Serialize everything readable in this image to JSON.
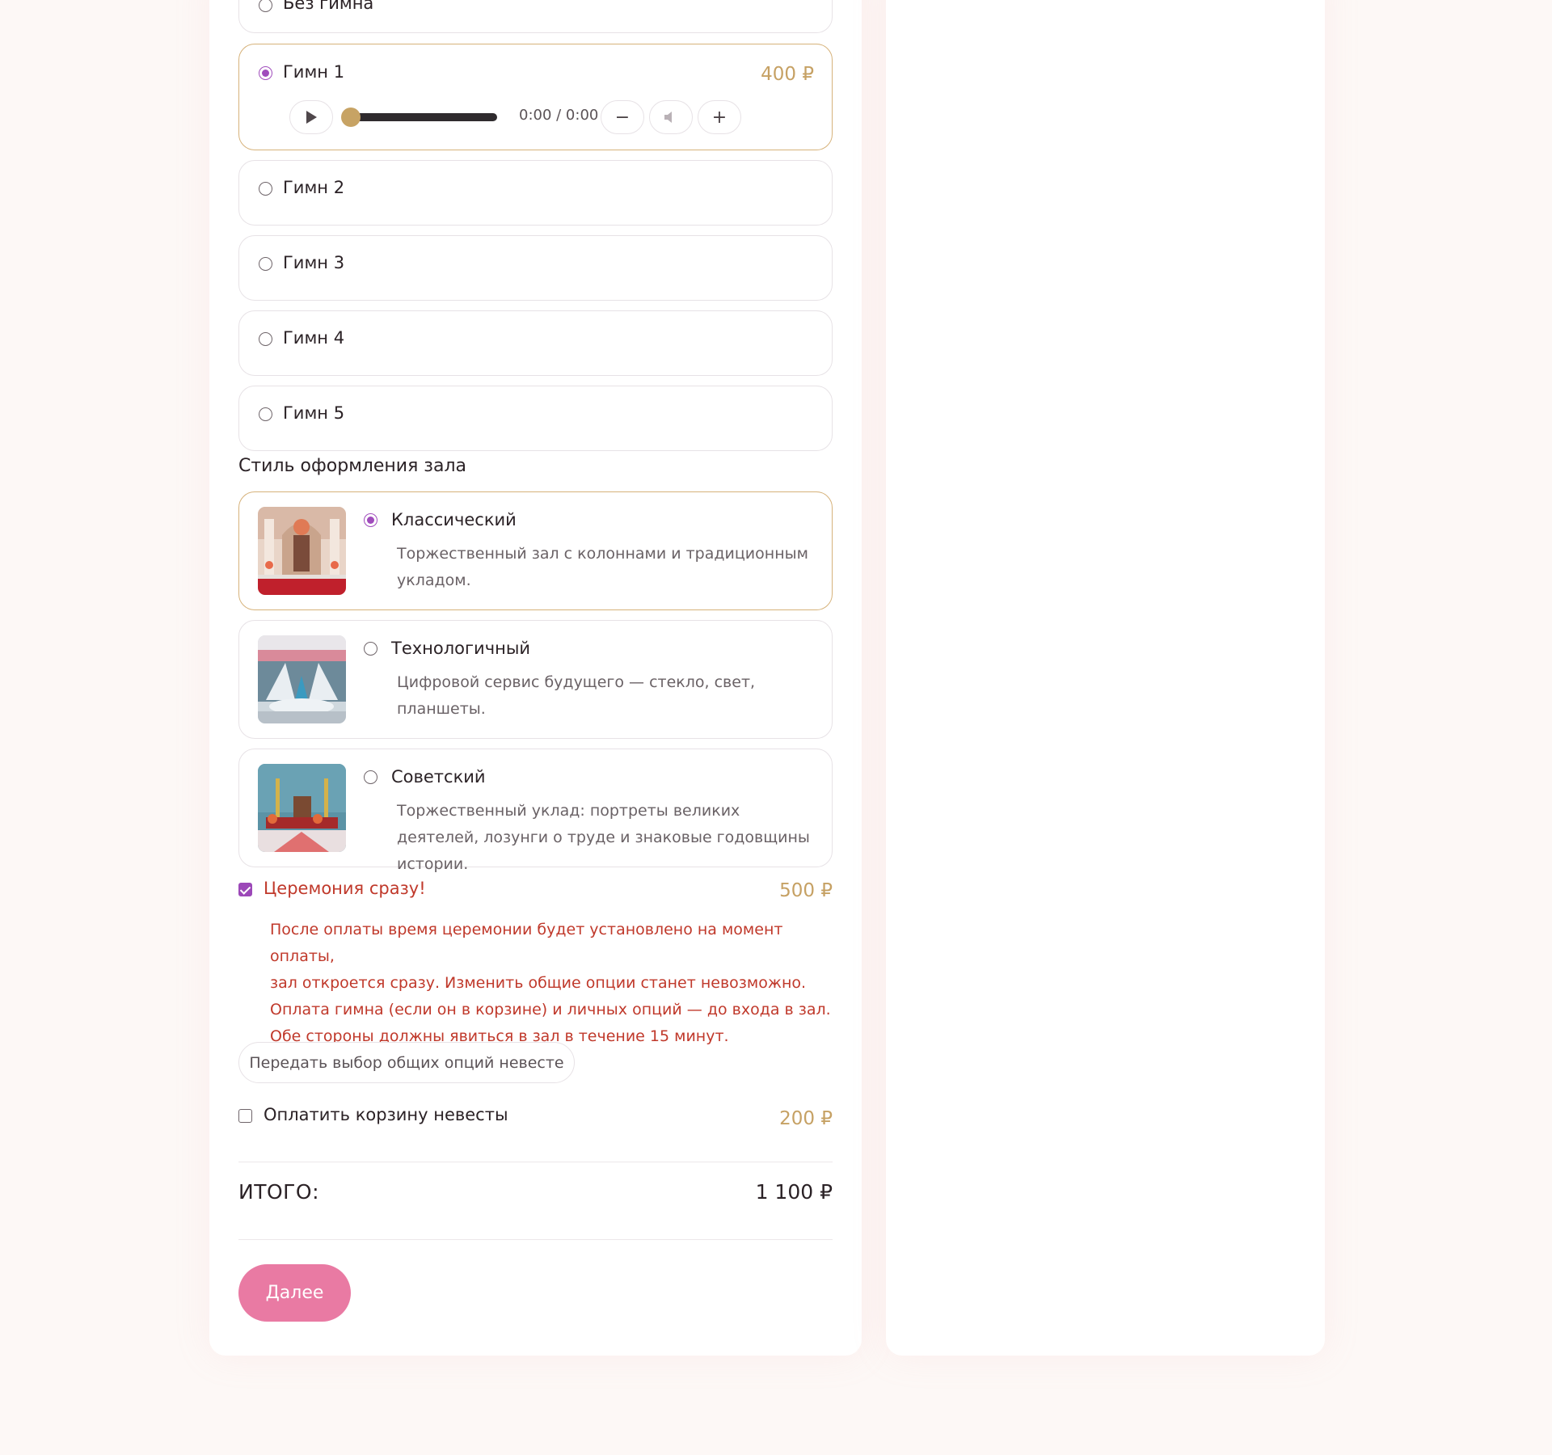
{
  "anthem": {
    "no_anthem_label": "Без гимна",
    "options": [
      {
        "label": "Гимн 1",
        "price": "400 ₽",
        "selected": true
      },
      {
        "label": "Гимн 2",
        "selected": false
      },
      {
        "label": "Гимн 3",
        "selected": false
      },
      {
        "label": "Гимн 4",
        "selected": false
      },
      {
        "label": "Гимн 5",
        "selected": false
      }
    ],
    "player": {
      "time": "0:00 / 0:00",
      "play_icon": "play-icon",
      "minus_label": "−",
      "volume_icon": "volume-icon",
      "plus_label": "+",
      "progress": 0
    }
  },
  "hall_style": {
    "title": "Стиль оформления зала",
    "options": [
      {
        "label": "Классический",
        "description": "Торжественный зал с колоннами и традиционным укладом.",
        "selected": true
      },
      {
        "label": "Технологичный",
        "description": "Цифровой сервис будущего — стекло, свет, планшеты.",
        "selected": false
      },
      {
        "label": "Советский",
        "description": "Торжественный уклад: портреты великих деятелей, лозунги о труде и знаковые годовщины истории.",
        "selected": false
      }
    ]
  },
  "ceremony_now": {
    "label": "Церемония сразу!",
    "price": "500 ₽",
    "checked": true,
    "warning_lines": [
      "После оплаты время церемонии будет установлено на момент оплаты,",
      "зал откроется сразу. Изменить общие опции станет невозможно.",
      "Оплата гимна (если он в корзине) и личных опций — до входа в зал.",
      "Обе стороны должны явиться в зал в течение 15 минут."
    ]
  },
  "transfer_button": "Передать выбор общих опций невесте",
  "pay_bride_cart": {
    "label": "Оплатить корзину невесты",
    "price": "200 ₽",
    "checked": false
  },
  "total": {
    "label": "ИТОГО:",
    "value": "1 100 ₽"
  },
  "next_button": "Далее",
  "colors": {
    "accent_purple": "#a04cbc",
    "gold": "#c6a164",
    "pink_button": "#e97aa3",
    "warning_red": "#c0392b"
  }
}
